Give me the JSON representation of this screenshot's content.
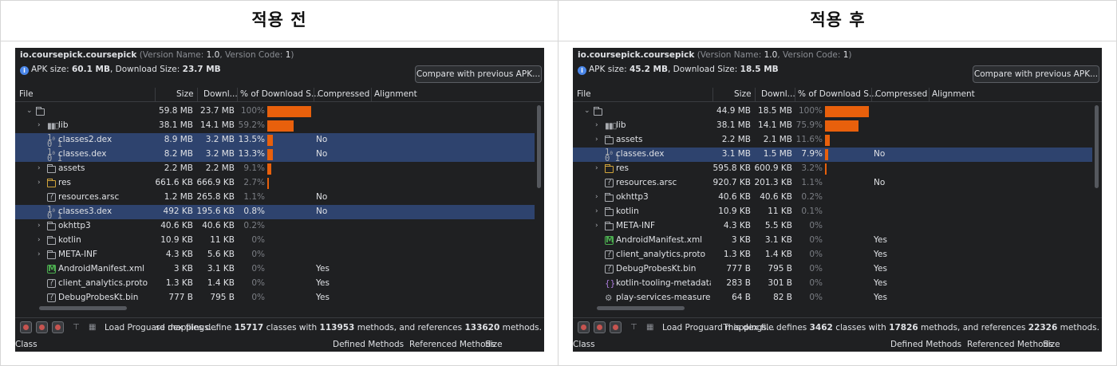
{
  "headings": {
    "before": "적용 전",
    "after": "적용 후"
  },
  "columns": {
    "file": "File",
    "size": "Size",
    "download": "Downl...",
    "pct": "% of Download S...",
    "compressed": "Compressed",
    "alignment": "Alignment"
  },
  "footer": {
    "class": "Class",
    "defined": "Defined Methods",
    "referenced": "Referenced Methods",
    "size": "Size"
  },
  "colors": {
    "bar": "#e8600c",
    "selection": "#2e436e",
    "panel": "#1f2022"
  },
  "before": {
    "package": "io.coursepick.coursepick",
    "version_prefix": " (Version Name: ",
    "version_name": "1.0",
    "version_mid": ", Version Code: ",
    "version_code": "1",
    "version_suffix": ")",
    "apk_prefix": "APK size: ",
    "apk_size": "60.1 MB",
    "download_prefix": ", Download Size: ",
    "download_size": "23.7 MB",
    "compare_button": "Compare with previous APK...",
    "load_proguard": "Load Proguard mappings...",
    "defs_text_1": "se dex files define ",
    "classes": "15717",
    "defs_text_2": " classes with ",
    "methods": "113953",
    "defs_text_3": " methods, and references ",
    "references": "133620",
    "defs_text_4": " methods.",
    "rows": [
      {
        "icon": "folder",
        "depth": 0,
        "expand": "open",
        "name": "",
        "size": "59.8 MB",
        "download": "23.7 MB",
        "pct": "100%",
        "bar": 1.0,
        "compressed": "",
        "sel": false,
        "dim": true
      },
      {
        "icon": "lib",
        "depth": 1,
        "expand": "closed",
        "name": "lib",
        "size": "38.1 MB",
        "download": "14.1 MB",
        "pct": "59.2%",
        "bar": 0.592,
        "compressed": "",
        "sel": false,
        "dim": true
      },
      {
        "icon": "dex",
        "depth": 1,
        "expand": "",
        "name": "classes2.dex",
        "size": "8.9 MB",
        "download": "3.2 MB",
        "pct": "13.5%",
        "bar": 0.135,
        "compressed": "No",
        "sel": true,
        "dim": false
      },
      {
        "icon": "dex",
        "depth": 1,
        "expand": "",
        "name": "classes.dex",
        "size": "8.2 MB",
        "download": "3.2 MB",
        "pct": "13.3%",
        "bar": 0.133,
        "compressed": "No",
        "sel": true,
        "dim": false
      },
      {
        "icon": "folder",
        "depth": 1,
        "expand": "closed",
        "name": "assets",
        "size": "2.2 MB",
        "download": "2.2 MB",
        "pct": "9.1%",
        "bar": 0.091,
        "compressed": "",
        "sel": false,
        "dim": true
      },
      {
        "icon": "folder-yellow",
        "depth": 1,
        "expand": "closed",
        "name": "res",
        "size": "661.6 KB",
        "download": "666.9 KB",
        "pct": "2.7%",
        "bar": 0.027,
        "compressed": "",
        "sel": false,
        "dim": true
      },
      {
        "icon": "q",
        "depth": 1,
        "expand": "",
        "name": "resources.arsc",
        "size": "1.2 MB",
        "download": "265.8 KB",
        "pct": "1.1%",
        "bar": 0,
        "compressed": "No",
        "sel": false,
        "dim": true
      },
      {
        "icon": "dex",
        "depth": 1,
        "expand": "",
        "name": "classes3.dex",
        "size": "492 KB",
        "download": "195.6 KB",
        "pct": "0.8%",
        "bar": 0,
        "compressed": "No",
        "sel": true,
        "dim": false
      },
      {
        "icon": "folder",
        "depth": 1,
        "expand": "closed",
        "name": "okhttp3",
        "size": "40.6 KB",
        "download": "40.6 KB",
        "pct": "0.2%",
        "bar": 0,
        "compressed": "",
        "sel": false,
        "dim": true
      },
      {
        "icon": "folder",
        "depth": 1,
        "expand": "closed",
        "name": "kotlin",
        "size": "10.9 KB",
        "download": "11 KB",
        "pct": "0%",
        "bar": 0,
        "compressed": "",
        "sel": false,
        "dim": true
      },
      {
        "icon": "folder",
        "depth": 1,
        "expand": "closed",
        "name": "META-INF",
        "size": "4.3 KB",
        "download": "5.6 KB",
        "pct": "0%",
        "bar": 0,
        "compressed": "",
        "sel": false,
        "dim": true
      },
      {
        "icon": "m",
        "depth": 1,
        "expand": "",
        "name": "AndroidManifest.xml",
        "size": "3 KB",
        "download": "3.1 KB",
        "pct": "0%",
        "bar": 0,
        "compressed": "Yes",
        "sel": false,
        "dim": true
      },
      {
        "icon": "q",
        "depth": 1,
        "expand": "",
        "name": "client_analytics.proto",
        "size": "1.3 KB",
        "download": "1.4 KB",
        "pct": "0%",
        "bar": 0,
        "compressed": "Yes",
        "sel": false,
        "dim": true
      },
      {
        "icon": "q",
        "depth": 1,
        "expand": "",
        "name": "DebugProbesKt.bin",
        "size": "777 B",
        "download": "795 B",
        "pct": "0%",
        "bar": 0,
        "compressed": "Yes",
        "sel": false,
        "dim": true
      }
    ]
  },
  "after": {
    "package": "io.coursepick.coursepick",
    "version_prefix": " (Version Name: ",
    "version_name": "1.0",
    "version_mid": ", Version Code: ",
    "version_code": "1",
    "version_suffix": ")",
    "apk_prefix": "APK size: ",
    "apk_size": "45.2 MB",
    "download_prefix": ", Download Size: ",
    "download_size": "18.5 MB",
    "compare_button": "Compare with previous APK...",
    "load_proguard": "Load Proguard mappings...",
    "defs_text_1": "This dex file defines ",
    "classes": "3462",
    "defs_text_2": " classes with ",
    "methods": "17826",
    "defs_text_3": " methods, and references ",
    "references": "22326",
    "defs_text_4": " methods.",
    "rows": [
      {
        "icon": "folder",
        "depth": 0,
        "expand": "open",
        "name": "",
        "size": "44.9 MB",
        "download": "18.5 MB",
        "pct": "100%",
        "bar": 1.0,
        "compressed": "",
        "sel": false,
        "dim": true
      },
      {
        "icon": "lib",
        "depth": 1,
        "expand": "closed",
        "name": "lib",
        "size": "38.1 MB",
        "download": "14.1 MB",
        "pct": "75.9%",
        "bar": 0.759,
        "compressed": "",
        "sel": false,
        "dim": true
      },
      {
        "icon": "folder",
        "depth": 1,
        "expand": "closed",
        "name": "assets",
        "size": "2.2 MB",
        "download": "2.1 MB",
        "pct": "11.6%",
        "bar": 0.116,
        "compressed": "",
        "sel": false,
        "dim": true
      },
      {
        "icon": "dex",
        "depth": 1,
        "expand": "",
        "name": "classes.dex",
        "size": "3.1 MB",
        "download": "1.5 MB",
        "pct": "7.9%",
        "bar": 0.079,
        "compressed": "No",
        "sel": true,
        "dim": false
      },
      {
        "icon": "folder-yellow",
        "depth": 1,
        "expand": "closed",
        "name": "res",
        "size": "595.8 KB",
        "download": "600.9 KB",
        "pct": "3.2%",
        "bar": 0.032,
        "compressed": "",
        "sel": false,
        "dim": true
      },
      {
        "icon": "q",
        "depth": 1,
        "expand": "",
        "name": "resources.arsc",
        "size": "920.7 KB",
        "download": "201.3 KB",
        "pct": "1.1%",
        "bar": 0,
        "compressed": "No",
        "sel": false,
        "dim": true
      },
      {
        "icon": "folder",
        "depth": 1,
        "expand": "closed",
        "name": "okhttp3",
        "size": "40.6 KB",
        "download": "40.6 KB",
        "pct": "0.2%",
        "bar": 0,
        "compressed": "",
        "sel": false,
        "dim": true
      },
      {
        "icon": "folder",
        "depth": 1,
        "expand": "closed",
        "name": "kotlin",
        "size": "10.9 KB",
        "download": "11 KB",
        "pct": "0.1%",
        "bar": 0,
        "compressed": "",
        "sel": false,
        "dim": true
      },
      {
        "icon": "folder",
        "depth": 1,
        "expand": "closed",
        "name": "META-INF",
        "size": "4.3 KB",
        "download": "5.5 KB",
        "pct": "0%",
        "bar": 0,
        "compressed": "",
        "sel": false,
        "dim": true
      },
      {
        "icon": "m",
        "depth": 1,
        "expand": "",
        "name": "AndroidManifest.xml",
        "size": "3 KB",
        "download": "3.1 KB",
        "pct": "0%",
        "bar": 0,
        "compressed": "Yes",
        "sel": false,
        "dim": true
      },
      {
        "icon": "q",
        "depth": 1,
        "expand": "",
        "name": "client_analytics.proto",
        "size": "1.3 KB",
        "download": "1.4 KB",
        "pct": "0%",
        "bar": 0,
        "compressed": "Yes",
        "sel": false,
        "dim": true
      },
      {
        "icon": "q",
        "depth": 1,
        "expand": "",
        "name": "DebugProbesKt.bin",
        "size": "777 B",
        "download": "795 B",
        "pct": "0%",
        "bar": 0,
        "compressed": "Yes",
        "sel": false,
        "dim": true
      },
      {
        "icon": "braces",
        "depth": 1,
        "expand": "",
        "name": "kotlin-tooling-metadata.json",
        "size": "283 B",
        "download": "301 B",
        "pct": "0%",
        "bar": 0,
        "compressed": "Yes",
        "sel": false,
        "dim": true
      },
      {
        "icon": "gear",
        "depth": 1,
        "expand": "",
        "name": "play-services-measurement",
        "size": "64 B",
        "download": "82 B",
        "pct": "0%",
        "bar": 0,
        "compressed": "Yes",
        "sel": false,
        "dim": true
      }
    ]
  }
}
